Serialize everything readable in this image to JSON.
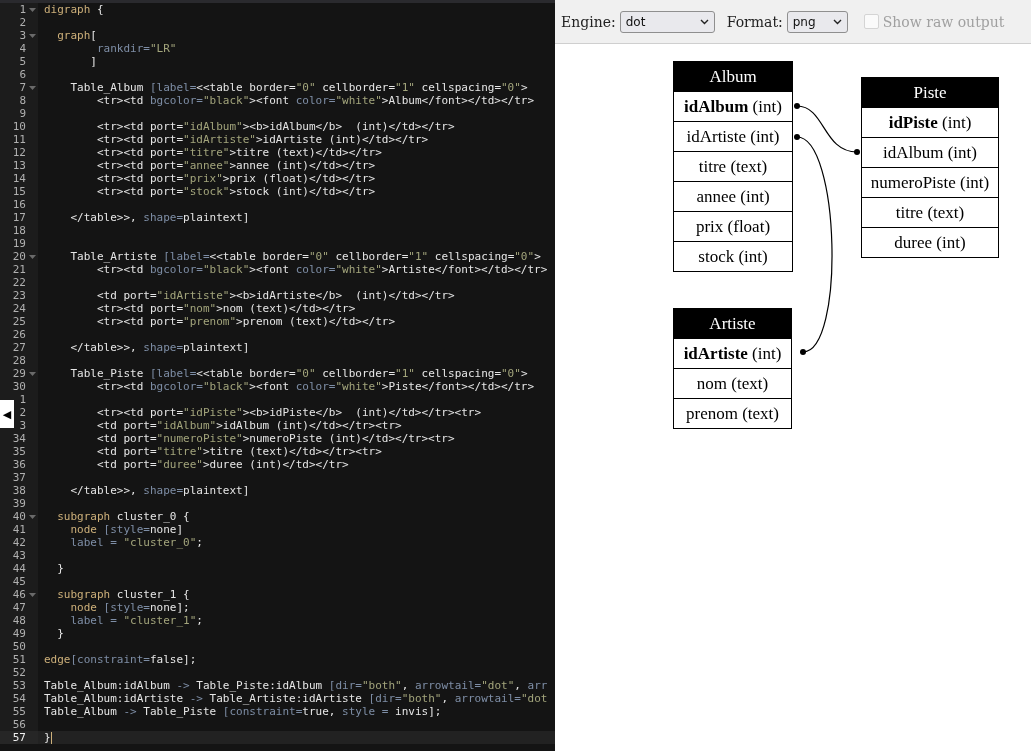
{
  "editor": {
    "toggle": "◀",
    "lines": [
      {
        "num": "1",
        "fold": true,
        "current": false,
        "code": [
          {
            "kind": "k",
            "text": "digraph"
          },
          {
            "kind": "p",
            "text": " {"
          }
        ]
      },
      {
        "num": "2",
        "fold": false,
        "current": false
      },
      {
        "num": "3",
        "fold": true,
        "current": false,
        "code": [
          {
            "kind": "k",
            "text": "  graph"
          },
          {
            "kind": "p",
            "text": "["
          }
        ]
      },
      {
        "num": "4",
        "fold": false,
        "current": false,
        "code": [
          {
            "kind": "a",
            "text": "        rankdir="
          },
          {
            "kind": "s",
            "text": "\"LR\""
          }
        ]
      },
      {
        "num": "5",
        "fold": false,
        "current": false,
        "code": [
          {
            "kind": "p",
            "text": "       ]"
          }
        ]
      },
      {
        "num": "6",
        "fold": false,
        "current": false
      },
      {
        "num": "7",
        "fold": true,
        "current": false,
        "code": [
          {
            "kind": "p",
            "text": "    Table_Album "
          },
          {
            "kind": "a",
            "text": "[label="
          },
          {
            "kind": "p",
            "text": "<<table border="
          },
          {
            "kind": "s",
            "text": "\"0\""
          },
          {
            "kind": "p",
            "text": " cellborder="
          },
          {
            "kind": "s",
            "text": "\"1\""
          },
          {
            "kind": "p",
            "text": " cellspacing="
          },
          {
            "kind": "s",
            "text": "\"0\""
          },
          {
            "kind": "p",
            "text": ">"
          }
        ]
      },
      {
        "num": "8",
        "fold": false,
        "current": false,
        "code": [
          {
            "kind": "p",
            "text": "        <tr><td "
          },
          {
            "kind": "a",
            "text": "bgcolor="
          },
          {
            "kind": "s",
            "text": "\"black\""
          },
          {
            "kind": "p",
            "text": "><font "
          },
          {
            "kind": "a",
            "text": "color="
          },
          {
            "kind": "s",
            "text": "\"white\""
          },
          {
            "kind": "p",
            "text": ">Album</font></td></tr>"
          }
        ]
      },
      {
        "num": "9",
        "fold": false,
        "current": false
      },
      {
        "num": "10",
        "fold": false,
        "current": false,
        "code": [
          {
            "kind": "p",
            "text": "        <tr><td port="
          },
          {
            "kind": "s",
            "text": "\"idAlbum\""
          },
          {
            "kind": "p",
            "text": "><b>idAlbum</b>  (int)</td></tr>"
          }
        ]
      },
      {
        "num": "11",
        "fold": false,
        "current": false,
        "code": [
          {
            "kind": "p",
            "text": "        <tr><td port="
          },
          {
            "kind": "s",
            "text": "\"idArtiste\""
          },
          {
            "kind": "p",
            "text": ">idArtiste (int)</td></tr>"
          }
        ]
      },
      {
        "num": "12",
        "fold": false,
        "current": false,
        "code": [
          {
            "kind": "p",
            "text": "        <tr><td port="
          },
          {
            "kind": "s",
            "text": "\"titre\""
          },
          {
            "kind": "p",
            "text": ">titre (text)</td></tr>"
          }
        ]
      },
      {
        "num": "13",
        "fold": false,
        "current": false,
        "code": [
          {
            "kind": "p",
            "text": "        <tr><td port="
          },
          {
            "kind": "s",
            "text": "\"annee\""
          },
          {
            "kind": "p",
            "text": ">annee (int)</td></tr>"
          }
        ]
      },
      {
        "num": "14",
        "fold": false,
        "current": false,
        "code": [
          {
            "kind": "p",
            "text": "        <tr><td port="
          },
          {
            "kind": "s",
            "text": "\"prix\""
          },
          {
            "kind": "p",
            "text": ">prix (float)</td></tr>"
          }
        ]
      },
      {
        "num": "15",
        "fold": false,
        "current": false,
        "code": [
          {
            "kind": "p",
            "text": "        <tr><td port="
          },
          {
            "kind": "s",
            "text": "\"stock\""
          },
          {
            "kind": "p",
            "text": ">stock (int)</td></tr>"
          }
        ]
      },
      {
        "num": "16",
        "fold": false,
        "current": false
      },
      {
        "num": "17",
        "fold": false,
        "current": false,
        "code": [
          {
            "kind": "p",
            "text": "    </table>>, "
          },
          {
            "kind": "a",
            "text": "shape="
          },
          {
            "kind": "p",
            "text": "plaintext]"
          }
        ]
      },
      {
        "num": "18",
        "fold": false,
        "current": false
      },
      {
        "num": "19",
        "fold": false,
        "current": false
      },
      {
        "num": "20",
        "fold": true,
        "current": false,
        "code": [
          {
            "kind": "p",
            "text": "    Table_Artiste "
          },
          {
            "kind": "a",
            "text": "[label="
          },
          {
            "kind": "p",
            "text": "<<table border="
          },
          {
            "kind": "s",
            "text": "\"0\""
          },
          {
            "kind": "p",
            "text": " cellborder="
          },
          {
            "kind": "s",
            "text": "\"1\""
          },
          {
            "kind": "p",
            "text": " cellspacing="
          },
          {
            "kind": "s",
            "text": "\"0\""
          },
          {
            "kind": "p",
            "text": ">"
          }
        ]
      },
      {
        "num": "21",
        "fold": false,
        "current": false,
        "code": [
          {
            "kind": "p",
            "text": "        <tr><td "
          },
          {
            "kind": "a",
            "text": "bgcolor="
          },
          {
            "kind": "s",
            "text": "\"black\""
          },
          {
            "kind": "p",
            "text": "><font "
          },
          {
            "kind": "a",
            "text": "color="
          },
          {
            "kind": "s",
            "text": "\"white\""
          },
          {
            "kind": "p",
            "text": ">Artiste</font></td></tr>"
          }
        ]
      },
      {
        "num": "22",
        "fold": false,
        "current": false
      },
      {
        "num": "23",
        "fold": false,
        "current": false,
        "code": [
          {
            "kind": "p",
            "text": "        <td port="
          },
          {
            "kind": "s",
            "text": "\"idArtiste\""
          },
          {
            "kind": "p",
            "text": "><b>idArtiste</b>  (int)</td></tr>"
          }
        ]
      },
      {
        "num": "24",
        "fold": false,
        "current": false,
        "code": [
          {
            "kind": "p",
            "text": "        <tr><td port="
          },
          {
            "kind": "s",
            "text": "\"nom\""
          },
          {
            "kind": "p",
            "text": ">nom (text)</td></tr>"
          }
        ]
      },
      {
        "num": "25",
        "fold": false,
        "current": false,
        "code": [
          {
            "kind": "p",
            "text": "        <tr><td port="
          },
          {
            "kind": "s",
            "text": "\"prenom\""
          },
          {
            "kind": "p",
            "text": ">prenom (text)</td></tr>"
          }
        ]
      },
      {
        "num": "26",
        "fold": false,
        "current": false
      },
      {
        "num": "27",
        "fold": false,
        "current": false,
        "code": [
          {
            "kind": "p",
            "text": "    </table>>, "
          },
          {
            "kind": "a",
            "text": "shape="
          },
          {
            "kind": "p",
            "text": "plaintext]"
          }
        ]
      },
      {
        "num": "28",
        "fold": false,
        "current": false
      },
      {
        "num": "29",
        "fold": true,
        "current": false,
        "code": [
          {
            "kind": "p",
            "text": "    Table_Piste "
          },
          {
            "kind": "a",
            "text": "[label="
          },
          {
            "kind": "p",
            "text": "<<table border="
          },
          {
            "kind": "s",
            "text": "\"0\""
          },
          {
            "kind": "p",
            "text": " cellborder="
          },
          {
            "kind": "s",
            "text": "\"1\""
          },
          {
            "kind": "p",
            "text": " cellspacing="
          },
          {
            "kind": "s",
            "text": "\"0\""
          },
          {
            "kind": "p",
            "text": ">"
          }
        ]
      },
      {
        "num": "30",
        "fold": false,
        "current": false,
        "code": [
          {
            "kind": "p",
            "text": "        <tr><td "
          },
          {
            "kind": "a",
            "text": "bgcolor="
          },
          {
            "kind": "s",
            "text": "\"black\""
          },
          {
            "kind": "p",
            "text": "><font "
          },
          {
            "kind": "a",
            "text": "color="
          },
          {
            "kind": "s",
            "text": "\"white\""
          },
          {
            "kind": "p",
            "text": ">Piste</font></td></tr>"
          }
        ]
      },
      {
        "num": "1",
        "fold": false,
        "current": false
      },
      {
        "num": "2",
        "fold": false,
        "current": false,
        "code": [
          {
            "kind": "p",
            "text": "        <tr><td port="
          },
          {
            "kind": "s",
            "text": "\"idPiste\""
          },
          {
            "kind": "p",
            "text": "><b>idPiste</b>  (int)</td></tr><tr>"
          }
        ]
      },
      {
        "num": "3",
        "fold": false,
        "current": false,
        "code": [
          {
            "kind": "p",
            "text": "        <td port="
          },
          {
            "kind": "s",
            "text": "\"idAlbum\""
          },
          {
            "kind": "p",
            "text": ">idAlbum (int)</td></tr><tr>"
          }
        ]
      },
      {
        "num": "34",
        "fold": false,
        "current": false,
        "code": [
          {
            "kind": "p",
            "text": "        <td port="
          },
          {
            "kind": "s",
            "text": "\"numeroPiste\""
          },
          {
            "kind": "p",
            "text": ">numeroPiste (int)</td></tr><tr>"
          }
        ]
      },
      {
        "num": "35",
        "fold": false,
        "current": false,
        "code": [
          {
            "kind": "p",
            "text": "        <td port="
          },
          {
            "kind": "s",
            "text": "\"titre\""
          },
          {
            "kind": "p",
            "text": ">titre (text)</td></tr><tr>"
          }
        ]
      },
      {
        "num": "36",
        "fold": false,
        "current": false,
        "code": [
          {
            "kind": "p",
            "text": "        <td port="
          },
          {
            "kind": "s",
            "text": "\"duree\""
          },
          {
            "kind": "p",
            "text": ">duree (int)</td></tr>"
          }
        ]
      },
      {
        "num": "37",
        "fold": false,
        "current": false
      },
      {
        "num": "38",
        "fold": false,
        "current": false,
        "code": [
          {
            "kind": "p",
            "text": "    </table>>, "
          },
          {
            "kind": "a",
            "text": "shape="
          },
          {
            "kind": "p",
            "text": "plaintext]"
          }
        ]
      },
      {
        "num": "39",
        "fold": false,
        "current": false
      },
      {
        "num": "40",
        "fold": true,
        "current": false,
        "code": [
          {
            "kind": "k",
            "text": "  subgraph"
          },
          {
            "kind": "p",
            "text": " cluster_0 {"
          }
        ]
      },
      {
        "num": "41",
        "fold": false,
        "current": false,
        "code": [
          {
            "kind": "k",
            "text": "    node"
          },
          {
            "kind": "a",
            "text": " [style="
          },
          {
            "kind": "p",
            "text": "none]"
          }
        ]
      },
      {
        "num": "42",
        "fold": false,
        "current": false,
        "code": [
          {
            "kind": "a",
            "text": "    label = "
          },
          {
            "kind": "s",
            "text": "\"cluster_0\""
          },
          {
            "kind": "p",
            "text": ";"
          }
        ]
      },
      {
        "num": "43",
        "fold": false,
        "current": false
      },
      {
        "num": "44",
        "fold": false,
        "current": false,
        "code": [
          {
            "kind": "p",
            "text": "  }"
          }
        ]
      },
      {
        "num": "45",
        "fold": false,
        "current": false
      },
      {
        "num": "46",
        "fold": true,
        "current": false,
        "code": [
          {
            "kind": "k",
            "text": "  subgraph"
          },
          {
            "kind": "p",
            "text": " cluster_1 {"
          }
        ]
      },
      {
        "num": "47",
        "fold": false,
        "current": false,
        "code": [
          {
            "kind": "k",
            "text": "    node"
          },
          {
            "kind": "a",
            "text": " [style="
          },
          {
            "kind": "p",
            "text": "none];"
          }
        ]
      },
      {
        "num": "48",
        "fold": false,
        "current": false,
        "code": [
          {
            "kind": "a",
            "text": "    label = "
          },
          {
            "kind": "s",
            "text": "\"cluster_1\""
          },
          {
            "kind": "p",
            "text": ";"
          }
        ]
      },
      {
        "num": "49",
        "fold": false,
        "current": false,
        "code": [
          {
            "kind": "p",
            "text": "  }"
          }
        ]
      },
      {
        "num": "50",
        "fold": false,
        "current": false
      },
      {
        "num": "51",
        "fold": false,
        "current": false,
        "code": [
          {
            "kind": "k",
            "text": "edge"
          },
          {
            "kind": "a",
            "text": "[constraint="
          },
          {
            "kind": "p",
            "text": "false];"
          }
        ]
      },
      {
        "num": "52",
        "fold": false,
        "current": false
      },
      {
        "num": "53",
        "fold": false,
        "current": false,
        "code": [
          {
            "kind": "p",
            "text": "Table_Album:idAlbum "
          },
          {
            "kind": "a",
            "text": "->"
          },
          {
            "kind": "p",
            "text": " Table_Piste:idAlbum "
          },
          {
            "kind": "a",
            "text": "[dir="
          },
          {
            "kind": "s",
            "text": "\"both\""
          },
          {
            "kind": "p",
            "text": ", "
          },
          {
            "kind": "a",
            "text": "arrowtail="
          },
          {
            "kind": "s",
            "text": "\"dot\""
          },
          {
            "kind": "p",
            "text": ", "
          },
          {
            "kind": "a",
            "text": "arr"
          }
        ]
      },
      {
        "num": "54",
        "fold": false,
        "current": false,
        "code": [
          {
            "kind": "p",
            "text": "Table_Album:idArtiste "
          },
          {
            "kind": "a",
            "text": "->"
          },
          {
            "kind": "p",
            "text": " Table_Artiste:idArtiste "
          },
          {
            "kind": "a",
            "text": "[dir="
          },
          {
            "kind": "s",
            "text": "\"both\""
          },
          {
            "kind": "p",
            "text": ", "
          },
          {
            "kind": "a",
            "text": "arrowtail="
          },
          {
            "kind": "s",
            "text": "\"dot"
          }
        ]
      },
      {
        "num": "55",
        "fold": false,
        "current": false,
        "code": [
          {
            "kind": "p",
            "text": "Table_Album "
          },
          {
            "kind": "a",
            "text": "->"
          },
          {
            "kind": "p",
            "text": " Table_Piste "
          },
          {
            "kind": "a",
            "text": "[constraint="
          },
          {
            "kind": "p",
            "text": "true, "
          },
          {
            "kind": "a",
            "text": "style = "
          },
          {
            "kind": "p",
            "text": "invis];"
          }
        ]
      },
      {
        "num": "56",
        "fold": false,
        "current": false
      },
      {
        "num": "57",
        "fold": false,
        "current": true,
        "code": [
          {
            "kind": "p",
            "text": "}"
          }
        ]
      }
    ]
  },
  "toolbar": {
    "engine": {
      "label": "Engine:",
      "value": "dot"
    },
    "format": {
      "label": "Format:",
      "value": "png"
    },
    "raw_output": {
      "label": "Show raw output",
      "checked": false,
      "disabled": true
    }
  },
  "graph": {
    "tables": [
      {
        "title": "Album",
        "rows": [
          "**idAlbum** (int)",
          "idArtiste (int)",
          "titre (text)",
          "annee (int)",
          "prix (float)",
          "stock (int)"
        ]
      },
      {
        "title": "Piste",
        "rows": [
          "**idPiste** (int)",
          "idAlbum (int)",
          "numeroPiste (int)",
          "titre (text)",
          "duree (int)"
        ]
      },
      {
        "title": "Artiste",
        "rows": [
          "**idArtiste** (int)",
          "nom (text)",
          "prenom (text)"
        ]
      }
    ]
  }
}
